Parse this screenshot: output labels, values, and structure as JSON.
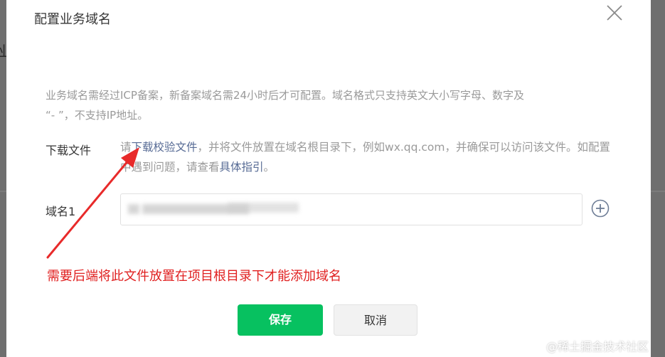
{
  "dialog": {
    "title": "配置业务域名",
    "close_icon": "close-icon"
  },
  "notice": {
    "line1": "业务域名需经过ICP备案，新备案域名需24小时后才可配置。域名格式只支持英文大小写字母、数字及",
    "line2": "“- ”，不支持IP地址。"
  },
  "download": {
    "label": "下载文件",
    "text_prefix": "请",
    "link_label": "下载校验文件",
    "text_middle": "，并将文件放置在域名根目录下，例如wx.qq.com，并确保可以访问该文件。如配置中遇到问题，请查看",
    "guide_link": "具体指引",
    "text_suffix": "。"
  },
  "domain": {
    "label": "域名1",
    "value": "",
    "add_icon": "plus-circle-icon"
  },
  "annotation": {
    "text": "需要后端将此文件放置在项目根目录下才能添加域名",
    "color": "#e02020"
  },
  "buttons": {
    "save_label": "保存",
    "cancel_label": "取消",
    "save_color": "#07c160"
  },
  "watermark": {
    "text": "@稀土掘金技术社区"
  }
}
